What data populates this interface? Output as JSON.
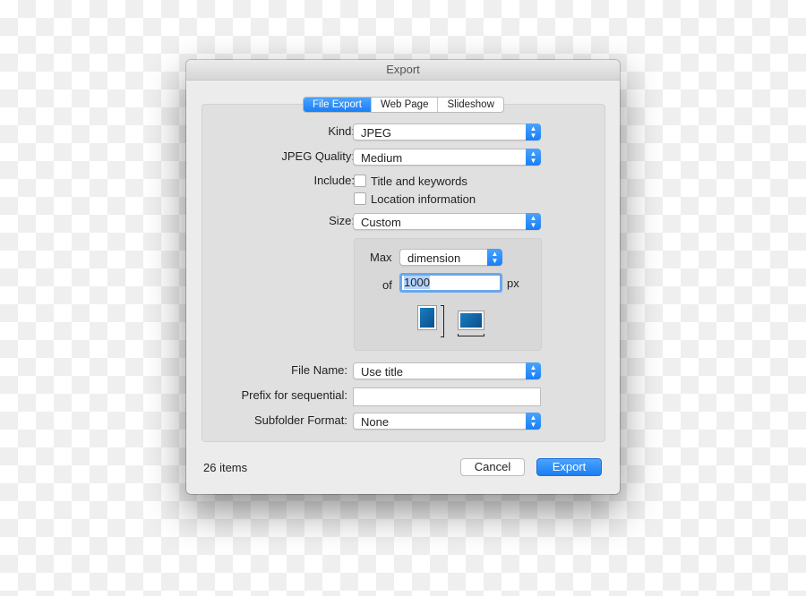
{
  "window": {
    "title": "Export"
  },
  "tabs": [
    {
      "label": "File Export",
      "active": true
    },
    {
      "label": "Web Page",
      "active": false
    },
    {
      "label": "Slideshow",
      "active": false
    }
  ],
  "form": {
    "kind": {
      "label": "Kind:",
      "value": "JPEG"
    },
    "quality": {
      "label": "JPEG Quality:",
      "value": "Medium"
    },
    "include": {
      "label": "Include:",
      "options": [
        {
          "label": "Title and keywords",
          "checked": false
        },
        {
          "label": "Location information",
          "checked": false
        }
      ]
    },
    "size": {
      "label": "Size:",
      "value": "Custom"
    },
    "max": {
      "label": "Max",
      "value": "dimension"
    },
    "of": {
      "label": "of",
      "value": "1000",
      "unit": "px"
    },
    "file_name": {
      "label": "File Name:",
      "value": "Use title"
    },
    "prefix": {
      "label": "Prefix for sequential:",
      "value": ""
    },
    "subfolder": {
      "label": "Subfolder Format:",
      "value": "None"
    }
  },
  "footer": {
    "count": "26 items",
    "cancel": "Cancel",
    "export": "Export"
  },
  "colors": {
    "accent": "#1a7ff5",
    "window": "#ececec",
    "panel": "#e0e0e0"
  }
}
